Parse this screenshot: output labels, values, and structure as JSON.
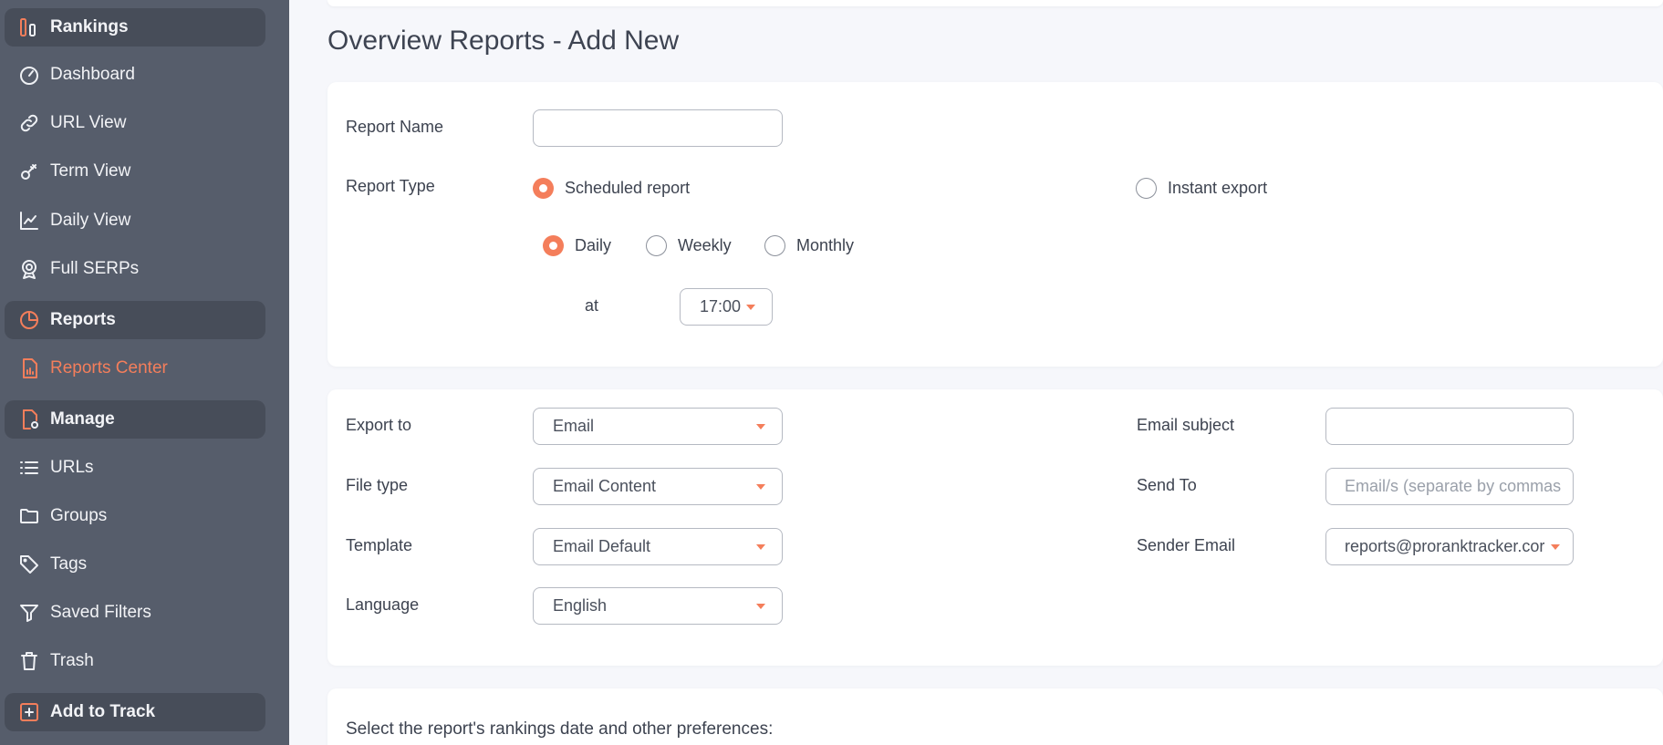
{
  "sidebar": {
    "items": [
      {
        "label": "Rankings",
        "icon": "rankings-icon"
      },
      {
        "label": "Dashboard",
        "icon": "dashboard-icon"
      },
      {
        "label": "URL View",
        "icon": "link-icon"
      },
      {
        "label": "Term View",
        "icon": "key-icon"
      },
      {
        "label": "Daily View",
        "icon": "line-chart-icon"
      },
      {
        "label": "Full SERPs",
        "icon": "serp-icon"
      },
      {
        "label": "Reports",
        "icon": "pie-chart-icon"
      },
      {
        "label": "Reports Center",
        "icon": "report-doc-icon"
      },
      {
        "label": "Manage",
        "icon": "manage-doc-icon"
      },
      {
        "label": "URLs",
        "icon": "list-icon"
      },
      {
        "label": "Groups",
        "icon": "folder-icon"
      },
      {
        "label": "Tags",
        "icon": "tag-icon"
      },
      {
        "label": "Saved Filters",
        "icon": "filter-icon"
      },
      {
        "label": "Trash",
        "icon": "trash-icon"
      },
      {
        "label": "Add to Track",
        "icon": "plus-square-icon"
      }
    ]
  },
  "page": {
    "title": "Overview Reports - Add New"
  },
  "form": {
    "report_name_label": "Report Name",
    "report_name_value": "",
    "report_type_label": "Report Type",
    "scheduled_label": "Scheduled report",
    "instant_label": "Instant export",
    "daily_label": "Daily",
    "weekly_label": "Weekly",
    "monthly_label": "Monthly",
    "at_label": "at",
    "time_value": "17:00",
    "export_to_label": "Export to",
    "export_to_value": "Email",
    "file_type_label": "File type",
    "file_type_value": "Email Content",
    "template_label": "Template",
    "template_value": "Email Default",
    "language_label": "Language",
    "language_value": "English",
    "email_subject_label": "Email subject",
    "email_subject_value": "",
    "send_to_label": "Send To",
    "send_to_placeholder": "Email/s (separate by commas",
    "sender_email_label": "Sender Email",
    "sender_email_value": "reports@proranktracker.cor",
    "prefs_text": "Select the report's rankings date and other preferences:"
  },
  "colors": {
    "accent": "#f47e5b",
    "sidebar_bg": "#565d6b"
  }
}
